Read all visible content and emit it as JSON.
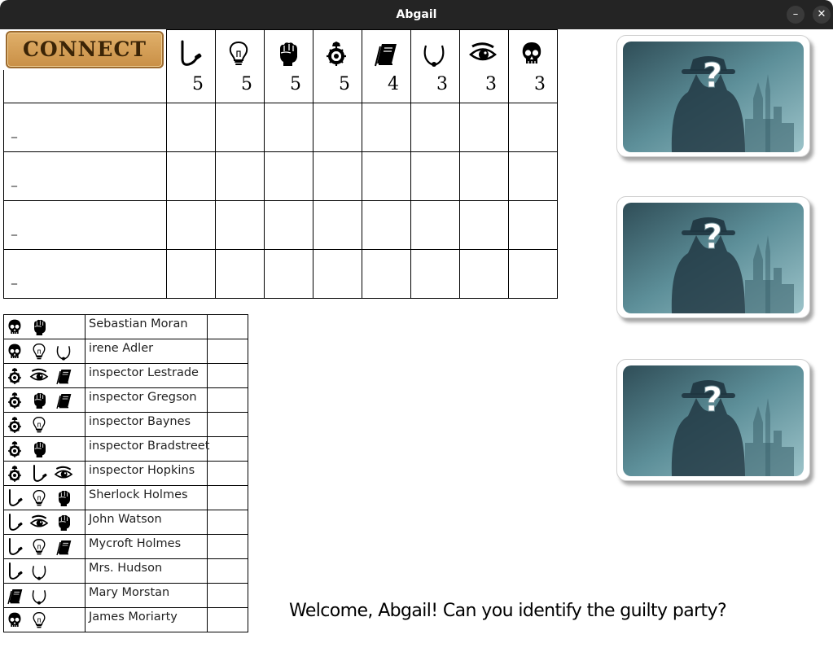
{
  "window": {
    "title": "Abgail",
    "minimize_glyph": "–",
    "close_glyph": "✕"
  },
  "connect_button": {
    "label": "CONNECT"
  },
  "evidence_columns": [
    {
      "icon": "pipe-icon",
      "count": "5"
    },
    {
      "icon": "lightbulb-icon",
      "count": "5"
    },
    {
      "icon": "fist-icon",
      "count": "5"
    },
    {
      "icon": "badge-icon",
      "count": "5"
    },
    {
      "icon": "notebook-icon",
      "count": "4"
    },
    {
      "icon": "necklace-icon",
      "count": "3"
    },
    {
      "icon": "eye-icon",
      "count": "3"
    },
    {
      "icon": "skull-icon",
      "count": "3"
    }
  ],
  "players": [
    "_",
    "_",
    "_",
    "_"
  ],
  "suspects": [
    {
      "name": "Sebastian Moran",
      "icons": [
        "skull-icon",
        "fist-icon"
      ]
    },
    {
      "name": "irene Adler",
      "icons": [
        "skull-icon",
        "lightbulb-icon",
        "necklace-icon"
      ]
    },
    {
      "name": "inspector Lestrade",
      "icons": [
        "badge-icon",
        "eye-icon",
        "notebook-icon"
      ]
    },
    {
      "name": "inspector Gregson",
      "icons": [
        "badge-icon",
        "fist-icon",
        "notebook-icon"
      ]
    },
    {
      "name": "inspector Baynes",
      "icons": [
        "badge-icon",
        "lightbulb-icon"
      ]
    },
    {
      "name": "inspector Bradstreet",
      "icons": [
        "badge-icon",
        "fist-icon"
      ]
    },
    {
      "name": "inspector Hopkins",
      "icons": [
        "badge-icon",
        "pipe-icon",
        "eye-icon"
      ]
    },
    {
      "name": "Sherlock Holmes",
      "icons": [
        "pipe-icon",
        "lightbulb-icon",
        "fist-icon"
      ]
    },
    {
      "name": "John Watson",
      "icons": [
        "pipe-icon",
        "eye-icon",
        "fist-icon"
      ]
    },
    {
      "name": "Mycroft Holmes",
      "icons": [
        "pipe-icon",
        "lightbulb-icon",
        "notebook-icon"
      ]
    },
    {
      "name": "Mrs. Hudson",
      "icons": [
        "pipe-icon",
        "necklace-icon"
      ]
    },
    {
      "name": "Mary Morstan",
      "icons": [
        "notebook-icon",
        "necklace-icon"
      ]
    },
    {
      "name": "James Moriarty",
      "icons": [
        "skull-icon",
        "lightbulb-icon"
      ]
    }
  ],
  "cards": [
    {
      "icon": "mystery-suspect-card-icon",
      "mark": "?"
    },
    {
      "icon": "mystery-suspect-card-icon",
      "mark": "?"
    },
    {
      "icon": "mystery-suspect-card-icon",
      "mark": "?"
    }
  ],
  "welcome_message": "Welcome, Abgail! Can you identify the guilty party?"
}
